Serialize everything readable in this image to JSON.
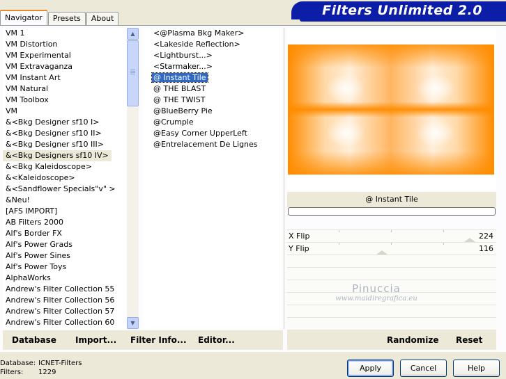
{
  "tabs": [
    {
      "label": "Navigator",
      "active": true
    },
    {
      "label": "Presets",
      "active": false
    },
    {
      "label": "About",
      "active": false
    }
  ],
  "logo_text": "Filters Unlimited 2.0",
  "categories": [
    "VM 1",
    "VM Distortion",
    "VM Experimental",
    "VM Extravaganza",
    "VM Instant Art",
    "VM Natural",
    "VM Toolbox",
    "VM",
    "&<Bkg Designer sf10 I>",
    "&<Bkg Designer sf10 II>",
    "&<Bkg Designer sf10 III>",
    "&<Bkg Designers sf10 IV>",
    "&<Bkg Kaleidoscope>",
    "&<Kaleidoscope>",
    "&<Sandflower Specials\"v\" >",
    "&Neu!",
    "[AFS IMPORT]",
    "AB Filters 2000",
    "Alf's Border FX",
    "Alf's Power Grads",
    "Alf's Power Sines",
    "Alf's Power Toys",
    "AlphaWorks",
    "Andrew's Filter Collection 55",
    "Andrew's Filter Collection 56",
    "Andrew's Filter Collection 57",
    "Andrew's Filter Collection 60"
  ],
  "selected_category_index": 11,
  "filters": [
    "<@Plasma Bkg Maker>",
    "<Lakeside Reflection>",
    "<Lightburst...>",
    "<Starmaker...>",
    "@ Instant Tile",
    "@ THE BLAST",
    "@ THE TWIST",
    "@BlueBerry Pie",
    "@Crumple",
    "@Easy Corner UpperLeft",
    "@Entrelacement De Lignes"
  ],
  "selected_filter_index": 4,
  "current_filter_name": "@ Instant Tile",
  "params": [
    {
      "label": "X Flip",
      "value": "224",
      "level": 224
    },
    {
      "label": "Y Flip",
      "value": "116",
      "level": 116
    }
  ],
  "watermark": {
    "line1": "Pinuccia",
    "line2": "www.maidiregrafica.eu"
  },
  "bottom_links": {
    "database": "Database",
    "import": "Import...",
    "filter_info": "Filter Info...",
    "editor": "Editor...",
    "randomize": "Randomize",
    "reset": "Reset"
  },
  "status": {
    "database_label": "Database:",
    "database_value": "ICNET-Filters",
    "filters_label": "Filters:",
    "filters_value": "1229"
  },
  "buttons": {
    "apply": "Apply",
    "cancel": "Cancel",
    "help": "Help"
  },
  "colors": {
    "accent_blue": "#0c1ea8",
    "selection": "#316ac5",
    "preview_orange": "#ff8c00"
  }
}
